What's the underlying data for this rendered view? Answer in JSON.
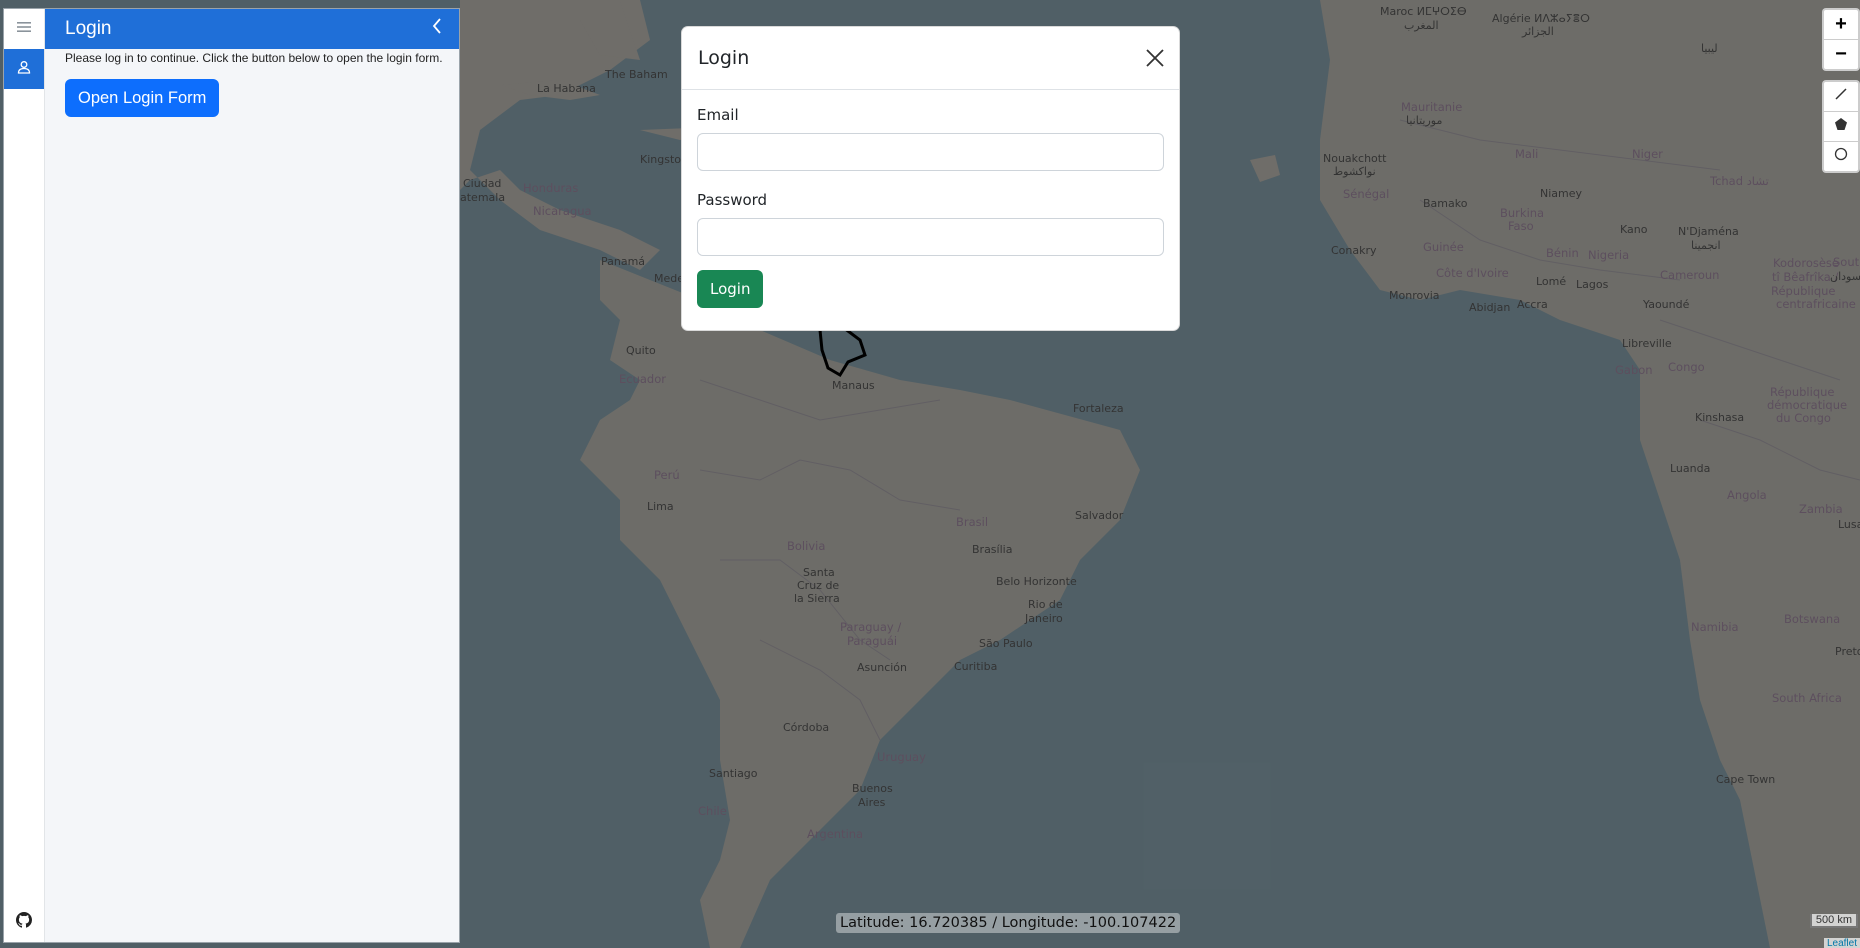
{
  "sidebar": {
    "tabs": [
      {
        "icon": "menu-icon"
      },
      {
        "icon": "user-icon"
      }
    ],
    "bottom_icon": "github-icon",
    "pane": {
      "title": "Login",
      "text": "Please log in to continue. Click the button below to open the login form.",
      "button_label": "Open Login Form"
    }
  },
  "modal": {
    "title": "Login",
    "email_label": "Email",
    "email_value": "",
    "password_label": "Password",
    "password_value": "",
    "submit_label": "Login"
  },
  "map": {
    "zoom_in": "+",
    "zoom_out": "−",
    "draw_tools": [
      "line-icon",
      "polygon-icon",
      "circle-icon"
    ],
    "coordinates": "Latitude: 16.720385 / Longitude: -100.107422",
    "scale": "500 km",
    "attribution": "Leaflet",
    "labels": [
      {
        "text": "La Habana"
      },
      {
        "text": "The Baham"
      },
      {
        "text": "Kingston"
      },
      {
        "text": "Ciudad"
      },
      {
        "text": "Honduras"
      },
      {
        "text": "atemala"
      },
      {
        "text": "Nicaragua"
      },
      {
        "text": "Panamá"
      },
      {
        "text": "Mede"
      },
      {
        "text": "Quito"
      },
      {
        "text": "Ecuador"
      },
      {
        "text": "Perú"
      },
      {
        "text": "Lima"
      },
      {
        "text": "Manaus"
      },
      {
        "text": "Fortaleza"
      },
      {
        "text": "Brasil"
      },
      {
        "text": "Salvador"
      },
      {
        "text": "Brasília"
      },
      {
        "text": "Bolivia"
      },
      {
        "text": "Santa"
      },
      {
        "text": "Cruz de"
      },
      {
        "text": "la Sierra"
      },
      {
        "text": "Belo Horizonte"
      },
      {
        "text": "Rio de"
      },
      {
        "text": "Janeiro"
      },
      {
        "text": "Paraguay /"
      },
      {
        "text": "Paraguái"
      },
      {
        "text": "São Paulo"
      },
      {
        "text": "Asunción"
      },
      {
        "text": "Curitiba"
      },
      {
        "text": "Córdoba"
      },
      {
        "text": "Uruguay"
      },
      {
        "text": "Santiago"
      },
      {
        "text": "Buenos"
      },
      {
        "text": "Aires"
      },
      {
        "text": "Chile"
      },
      {
        "text": "Argentina"
      },
      {
        "text": "Maroc ⵍⵎⵖⵔⵉⴱ"
      },
      {
        "text": "المغرب"
      },
      {
        "text": "Algérie ⵍⴷⵣⴰⵢⴻⵔ"
      },
      {
        "text": "الجزائر"
      },
      {
        "text": "ليبيا"
      },
      {
        "text": "Mauritanie"
      },
      {
        "text": "موريتانيا"
      },
      {
        "text": "Mali"
      },
      {
        "text": "Niger"
      },
      {
        "text": "Nouakchott"
      },
      {
        "text": "نواكشوط"
      },
      {
        "text": "Sénégal"
      },
      {
        "text": "Bamako"
      },
      {
        "text": "Niamey"
      },
      {
        "text": "Burkina"
      },
      {
        "text": "Faso"
      },
      {
        "text": "Tchad تشاد"
      },
      {
        "text": "Kano"
      },
      {
        "text": "N'Djaména"
      },
      {
        "text": "انجمينا"
      },
      {
        "text": "Conakry"
      },
      {
        "text": "Guinée"
      },
      {
        "text": "Bénin"
      },
      {
        "text": "Nigeria"
      },
      {
        "text": "Côte d'Ivoire"
      },
      {
        "text": "Lomé"
      },
      {
        "text": "Lagos"
      },
      {
        "text": "Cameroun"
      },
      {
        "text": "Monrovia"
      },
      {
        "text": "Abidjan"
      },
      {
        "text": "Accra"
      },
      {
        "text": "Yaoundé"
      },
      {
        "text": "Kodorosèse"
      },
      {
        "text": "tî Bêafrîka /"
      },
      {
        "text": "République"
      },
      {
        "text": "centrafricaine"
      },
      {
        "text": "South"
      },
      {
        "text": "السودان"
      },
      {
        "text": "Libreville"
      },
      {
        "text": "Gabon"
      },
      {
        "text": "Congo"
      },
      {
        "text": "République"
      },
      {
        "text": "démocratique"
      },
      {
        "text": "du Congo"
      },
      {
        "text": "Kinshasa"
      },
      {
        "text": "Luanda"
      },
      {
        "text": "Angola"
      },
      {
        "text": "Zambia"
      },
      {
        "text": "Lusa"
      },
      {
        "text": "Namibia"
      },
      {
        "text": "Botswana"
      },
      {
        "text": "Pretor"
      },
      {
        "text": "South Africa"
      },
      {
        "text": "Cape Town"
      }
    ]
  }
}
